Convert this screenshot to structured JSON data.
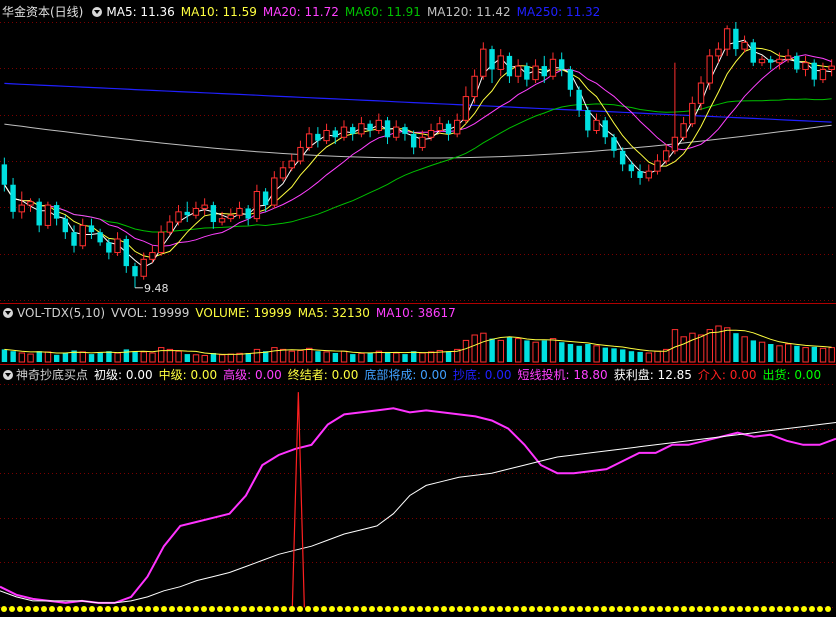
{
  "colors": {
    "up": "#ff3030",
    "down": "#00e0e0",
    "ma5": "#ffffff",
    "ma10": "#ffff40",
    "ma20": "#ff40ff",
    "ma60": "#00c000",
    "ma120": "#c0c0c0",
    "ma250": "#2020ff",
    "grid": "#7a0000",
    "magenta": "#ff33ff",
    "white": "#ffffff",
    "red": "#ff2020",
    "yellow": "#ffff00"
  },
  "price_header": {
    "title": "华金资本(日线)",
    "items": [
      {
        "label": "MA5: 11.36",
        "color": "#ffffff"
      },
      {
        "label": "MA10: 11.59",
        "color": "#ffff40"
      },
      {
        "label": "MA20: 11.72",
        "color": "#ff40ff"
      },
      {
        "label": "MA60: 11.91",
        "color": "#00c000"
      },
      {
        "label": "MA120: 11.42",
        "color": "#c0c0c0"
      },
      {
        "label": "MA250: 11.32",
        "color": "#2020ff"
      }
    ]
  },
  "volume_header": {
    "items": [
      {
        "label": "VOL-TDX(5,10)",
        "color": "#d0d0d0"
      },
      {
        "label": "VVOL: 19999",
        "color": "#d0d0d0"
      },
      {
        "label": "VOLUME: 19999",
        "color": "#ffff40"
      },
      {
        "label": "MA5: 32130",
        "color": "#ffff40"
      },
      {
        "label": "MA10: 38617",
        "color": "#ff40ff"
      }
    ]
  },
  "indicator_header": {
    "items": [
      {
        "label": "神奇抄底买点",
        "color": "#d0d0d0"
      },
      {
        "label": "初级: 0.00",
        "color": "#ffffff"
      },
      {
        "label": "中级: 0.00",
        "color": "#ffff40"
      },
      {
        "label": "高级: 0.00",
        "color": "#ff40ff"
      },
      {
        "label": "终结者: 0.00",
        "color": "#ffff40"
      },
      {
        "label": "底部将成: 0.00",
        "color": "#40a0ff"
      },
      {
        "label": "抄底: 0.00",
        "color": "#2020ff"
      },
      {
        "label": "短线投机: 18.80",
        "color": "#ff40ff"
      },
      {
        "label": "获利盘: 12.85",
        "color": "#ffffff"
      },
      {
        "label": "介入: 0.00",
        "color": "#ff2020"
      },
      {
        "label": "出货: 0.00",
        "color": "#00ff00"
      }
    ]
  },
  "chart_data": [
    {
      "type": "candlestick",
      "low_annotation": "9.48",
      "ylim": [
        9.3,
        13.4
      ],
      "candles": [
        [
          11.3,
          11.0,
          11.4,
          10.9
        ],
        [
          11.0,
          10.6,
          11.1,
          10.5
        ],
        [
          10.6,
          10.7,
          10.9,
          10.5
        ],
        [
          10.7,
          10.75,
          10.8,
          10.6
        ],
        [
          10.75,
          10.4,
          10.8,
          10.3
        ],
        [
          10.4,
          10.7,
          10.75,
          10.35
        ],
        [
          10.7,
          10.5,
          10.75,
          10.4
        ],
        [
          10.5,
          10.3,
          10.55,
          10.2
        ],
        [
          10.3,
          10.1,
          10.4,
          10.0
        ],
        [
          10.1,
          10.4,
          10.5,
          10.05
        ],
        [
          10.4,
          10.3,
          10.5,
          10.2
        ],
        [
          10.3,
          10.15,
          10.35,
          10.1
        ],
        [
          10.15,
          10.0,
          10.2,
          9.9
        ],
        [
          10.0,
          10.2,
          10.3,
          9.95
        ],
        [
          10.2,
          9.8,
          10.25,
          9.7
        ],
        [
          9.8,
          9.65,
          9.85,
          9.48
        ],
        [
          9.65,
          9.9,
          10.0,
          9.6
        ],
        [
          9.9,
          10.0,
          10.1,
          9.85
        ],
        [
          10.0,
          10.3,
          10.4,
          9.95
        ],
        [
          10.3,
          10.45,
          10.55,
          10.25
        ],
        [
          10.45,
          10.6,
          10.7,
          10.4
        ],
        [
          10.6,
          10.55,
          10.75,
          10.45
        ],
        [
          10.55,
          10.65,
          10.75,
          10.5
        ],
        [
          10.65,
          10.7,
          10.8,
          10.55
        ],
        [
          10.7,
          10.45,
          10.75,
          10.35
        ],
        [
          10.45,
          10.5,
          10.6,
          10.4
        ],
        [
          10.5,
          10.55,
          10.65,
          10.45
        ],
        [
          10.55,
          10.65,
          10.75,
          10.5
        ],
        [
          10.65,
          10.5,
          10.7,
          10.4
        ],
        [
          10.5,
          10.9,
          11.0,
          10.45
        ],
        [
          10.9,
          10.7,
          10.95,
          10.6
        ],
        [
          10.7,
          11.1,
          11.2,
          10.65
        ],
        [
          11.1,
          11.25,
          11.35,
          11.05
        ],
        [
          11.25,
          11.35,
          11.45,
          11.2
        ],
        [
          11.35,
          11.55,
          11.65,
          11.3
        ],
        [
          11.55,
          11.75,
          11.85,
          11.5
        ],
        [
          11.75,
          11.65,
          11.85,
          11.55
        ],
        [
          11.65,
          11.8,
          11.9,
          11.6
        ],
        [
          11.8,
          11.7,
          11.85,
          11.6
        ],
        [
          11.7,
          11.85,
          11.95,
          11.65
        ],
        [
          11.85,
          11.75,
          11.9,
          11.65
        ],
        [
          11.75,
          11.9,
          12.0,
          11.7
        ],
        [
          11.9,
          11.8,
          11.95,
          11.7
        ],
        [
          11.8,
          11.95,
          12.05,
          11.75
        ],
        [
          11.95,
          11.7,
          12.0,
          11.6
        ],
        [
          11.7,
          11.85,
          11.95,
          11.65
        ],
        [
          11.85,
          11.75,
          11.9,
          11.65
        ],
        [
          11.75,
          11.55,
          11.8,
          11.45
        ],
        [
          11.55,
          11.7,
          11.8,
          11.5
        ],
        [
          11.7,
          11.8,
          11.9,
          11.65
        ],
        [
          11.8,
          11.9,
          12.0,
          11.75
        ],
        [
          11.9,
          11.75,
          11.95,
          11.65
        ],
        [
          11.75,
          11.95,
          12.05,
          11.7
        ],
        [
          11.95,
          12.3,
          12.45,
          11.9
        ],
        [
          12.3,
          12.6,
          12.7,
          12.2
        ],
        [
          12.6,
          13.0,
          13.1,
          12.55
        ],
        [
          13.0,
          12.7,
          13.05,
          12.5
        ],
        [
          12.7,
          12.9,
          13.0,
          12.6
        ],
        [
          12.9,
          12.6,
          12.95,
          12.5
        ],
        [
          12.6,
          12.75,
          12.85,
          12.5
        ],
        [
          12.75,
          12.55,
          12.8,
          12.45
        ],
        [
          12.55,
          12.75,
          12.85,
          12.5
        ],
        [
          12.75,
          12.6,
          12.9,
          12.5
        ],
        [
          12.6,
          12.85,
          12.95,
          12.55
        ],
        [
          12.85,
          12.7,
          12.95,
          12.6
        ],
        [
          12.7,
          12.4,
          12.75,
          12.3
        ],
        [
          12.4,
          12.1,
          12.45,
          12.0
        ],
        [
          12.1,
          11.8,
          12.15,
          11.7
        ],
        [
          11.8,
          11.95,
          12.05,
          11.75
        ],
        [
          11.95,
          11.7,
          12.0,
          11.6
        ],
        [
          11.7,
          11.5,
          11.75,
          11.4
        ],
        [
          11.5,
          11.3,
          11.55,
          11.2
        ],
        [
          11.3,
          11.2,
          11.35,
          11.1
        ],
        [
          11.2,
          11.1,
          11.3,
          11.0
        ],
        [
          11.1,
          11.2,
          11.3,
          11.05
        ],
        [
          11.2,
          11.35,
          11.45,
          11.15
        ],
        [
          11.35,
          11.5,
          11.6,
          11.3
        ],
        [
          11.5,
          11.7,
          12.8,
          11.45
        ],
        [
          11.7,
          11.9,
          12.0,
          11.65
        ],
        [
          11.9,
          12.2,
          12.3,
          11.85
        ],
        [
          12.2,
          12.5,
          12.6,
          12.1
        ],
        [
          12.5,
          12.9,
          13.0,
          12.4
        ],
        [
          12.9,
          13.0,
          13.1,
          12.8
        ],
        [
          13.0,
          13.3,
          13.35,
          12.9
        ],
        [
          13.3,
          13.0,
          13.4,
          12.9
        ],
        [
          13.0,
          13.1,
          13.2,
          12.95
        ],
        [
          13.1,
          12.8,
          13.15,
          12.75
        ],
        [
          12.8,
          12.85,
          12.9,
          12.75
        ],
        [
          12.85,
          12.8,
          12.9,
          12.7
        ],
        [
          12.8,
          12.85,
          12.95,
          12.7
        ],
        [
          12.85,
          12.9,
          13.0,
          12.8
        ],
        [
          12.9,
          12.7,
          12.95,
          12.65
        ],
        [
          12.7,
          12.8,
          12.9,
          12.6
        ],
        [
          12.8,
          12.55,
          12.85,
          12.45
        ],
        [
          12.55,
          12.7,
          12.8,
          12.5
        ],
        [
          12.7,
          12.75,
          12.85,
          12.6
        ]
      ]
    },
    {
      "type": "bar",
      "values": [
        0.35,
        0.3,
        0.25,
        0.22,
        0.3,
        0.28,
        0.2,
        0.25,
        0.32,
        0.28,
        0.22,
        0.26,
        0.3,
        0.25,
        0.35,
        0.3,
        0.28,
        0.25,
        0.4,
        0.35,
        0.3,
        0.22,
        0.2,
        0.18,
        0.25,
        0.2,
        0.22,
        0.24,
        0.25,
        0.35,
        0.3,
        0.4,
        0.35,
        0.3,
        0.32,
        0.38,
        0.3,
        0.28,
        0.25,
        0.3,
        0.22,
        0.24,
        0.26,
        0.3,
        0.28,
        0.25,
        0.22,
        0.3,
        0.25,
        0.28,
        0.32,
        0.3,
        0.35,
        0.6,
        0.75,
        0.8,
        0.65,
        0.6,
        0.7,
        0.65,
        0.6,
        0.55,
        0.6,
        0.65,
        0.55,
        0.5,
        0.45,
        0.5,
        0.45,
        0.4,
        0.38,
        0.35,
        0.3,
        0.28,
        0.25,
        0.3,
        0.35,
        0.9,
        0.7,
        0.8,
        0.75,
        0.9,
        1.0,
        0.95,
        0.8,
        0.7,
        0.6,
        0.55,
        0.5,
        0.45,
        0.5,
        0.45,
        0.4,
        0.42,
        0.38,
        0.4
      ]
    },
    {
      "type": "line",
      "ylim": [
        0,
        110
      ],
      "series": [
        {
          "color": "magenta",
          "values": [
            10,
            6,
            4,
            3,
            2,
            3,
            2,
            2,
            5,
            15,
            30,
            40,
            42,
            44,
            46,
            55,
            70,
            75,
            78,
            80,
            90,
            95,
            96,
            97,
            98,
            96,
            97,
            96,
            95,
            94,
            92,
            88,
            80,
            70,
            66,
            66,
            67,
            68,
            72,
            76,
            76,
            80,
            80,
            82,
            84,
            86,
            84,
            85,
            82,
            80,
            80,
            83
          ]
        },
        {
          "color": "white",
          "values": [
            8,
            5,
            3,
            3,
            3,
            3,
            2,
            2,
            3,
            5,
            8,
            10,
            13,
            15,
            17,
            20,
            23,
            26,
            28,
            30,
            33,
            36,
            38,
            40,
            46,
            55,
            60,
            62,
            64,
            65,
            66,
            68,
            70,
            72,
            74,
            75,
            76,
            77,
            78,
            79,
            80,
            81,
            82,
            83,
            84,
            85,
            86,
            87,
            88,
            89,
            90,
            91
          ]
        }
      ],
      "spike_index": 18,
      "spike_value": 106
    }
  ]
}
